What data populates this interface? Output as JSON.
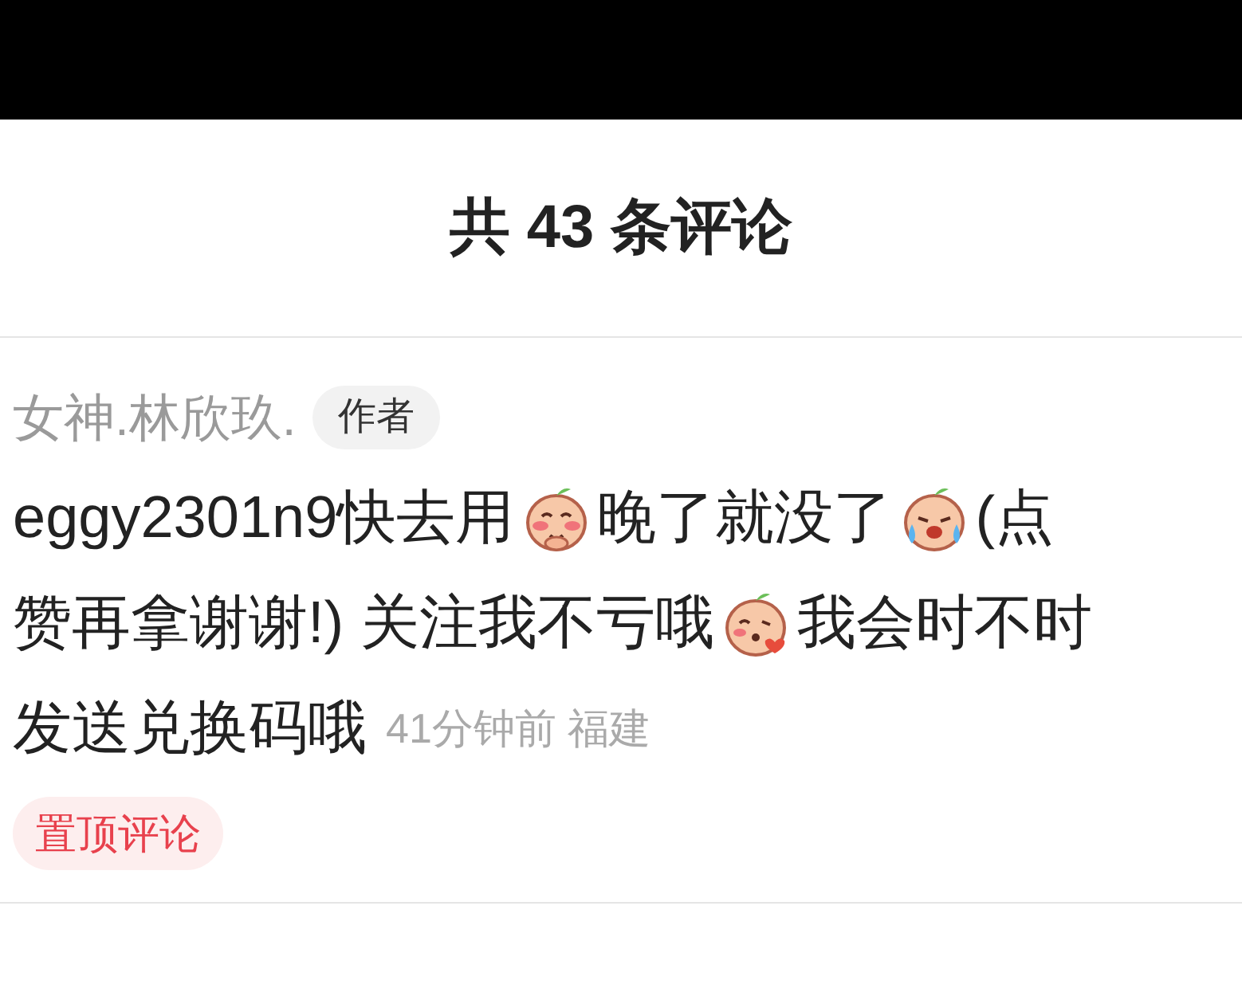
{
  "header": {
    "title": "共 43 条评论"
  },
  "comments": [
    {
      "author": "女神.林欣玖.",
      "author_badge": "作者",
      "lines": [
        [
          {
            "kind": "text",
            "text": "eggy2301n9快去用"
          },
          {
            "kind": "emoji"
          },
          {
            "kind": "text",
            "text": "晚了就没了"
          },
          {
            "kind": "emoji"
          },
          {
            "kind": "text",
            "text": "(点"
          }
        ],
        [
          {
            "kind": "text",
            "text": "赞再拿谢谢!) 关注我不亏哦"
          },
          {
            "kind": "emoji"
          },
          {
            "kind": "text",
            "text": "我会时不时"
          }
        ],
        [
          {
            "kind": "text",
            "text": "发送兑换码哦"
          }
        ]
      ],
      "time": "41分钟前",
      "location": "福建",
      "pinned_label": "置顶评论"
    }
  ]
}
